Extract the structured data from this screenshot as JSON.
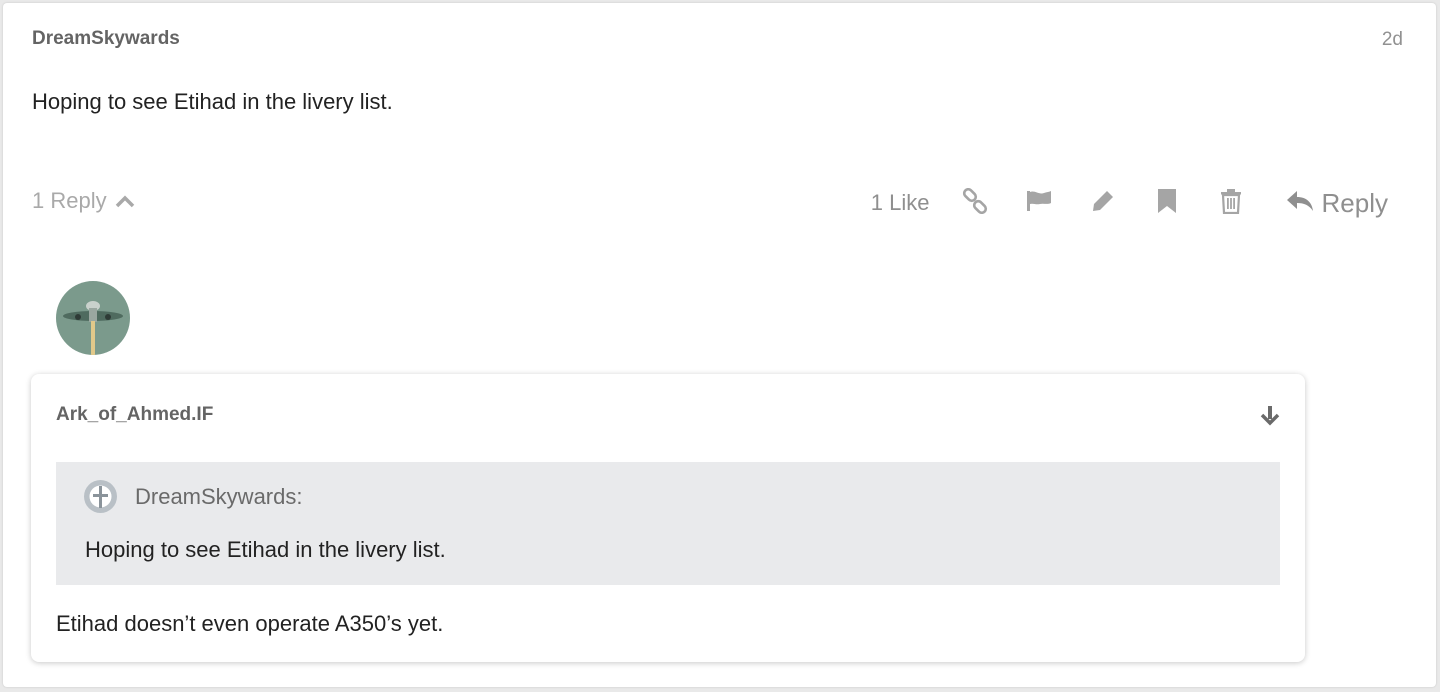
{
  "post": {
    "username": "DreamSkywards",
    "date": "2d",
    "body": "Hoping to see Etihad in the livery list.",
    "replies_label": "1 Reply",
    "like_label": "1 Like",
    "reply_label": "Reply",
    "icons": [
      "chevron-up-icon",
      "link-icon",
      "flag-icon",
      "pencil-icon",
      "bookmark-icon",
      "trash-icon",
      "reply-arrow-icon"
    ]
  },
  "reply": {
    "username": "Ark_of_Ahmed.IF",
    "quote": {
      "author": "DreamSkywards:",
      "text": "Hoping to see Etihad in the livery list."
    },
    "body": "Etihad doesn’t even operate A350’s yet."
  },
  "colors": {
    "muted_text": "#a9a9a9",
    "action_icon": "#a5a5a5",
    "quote_background": "#e9eaec",
    "avatar_background": "#7b9a8c"
  }
}
